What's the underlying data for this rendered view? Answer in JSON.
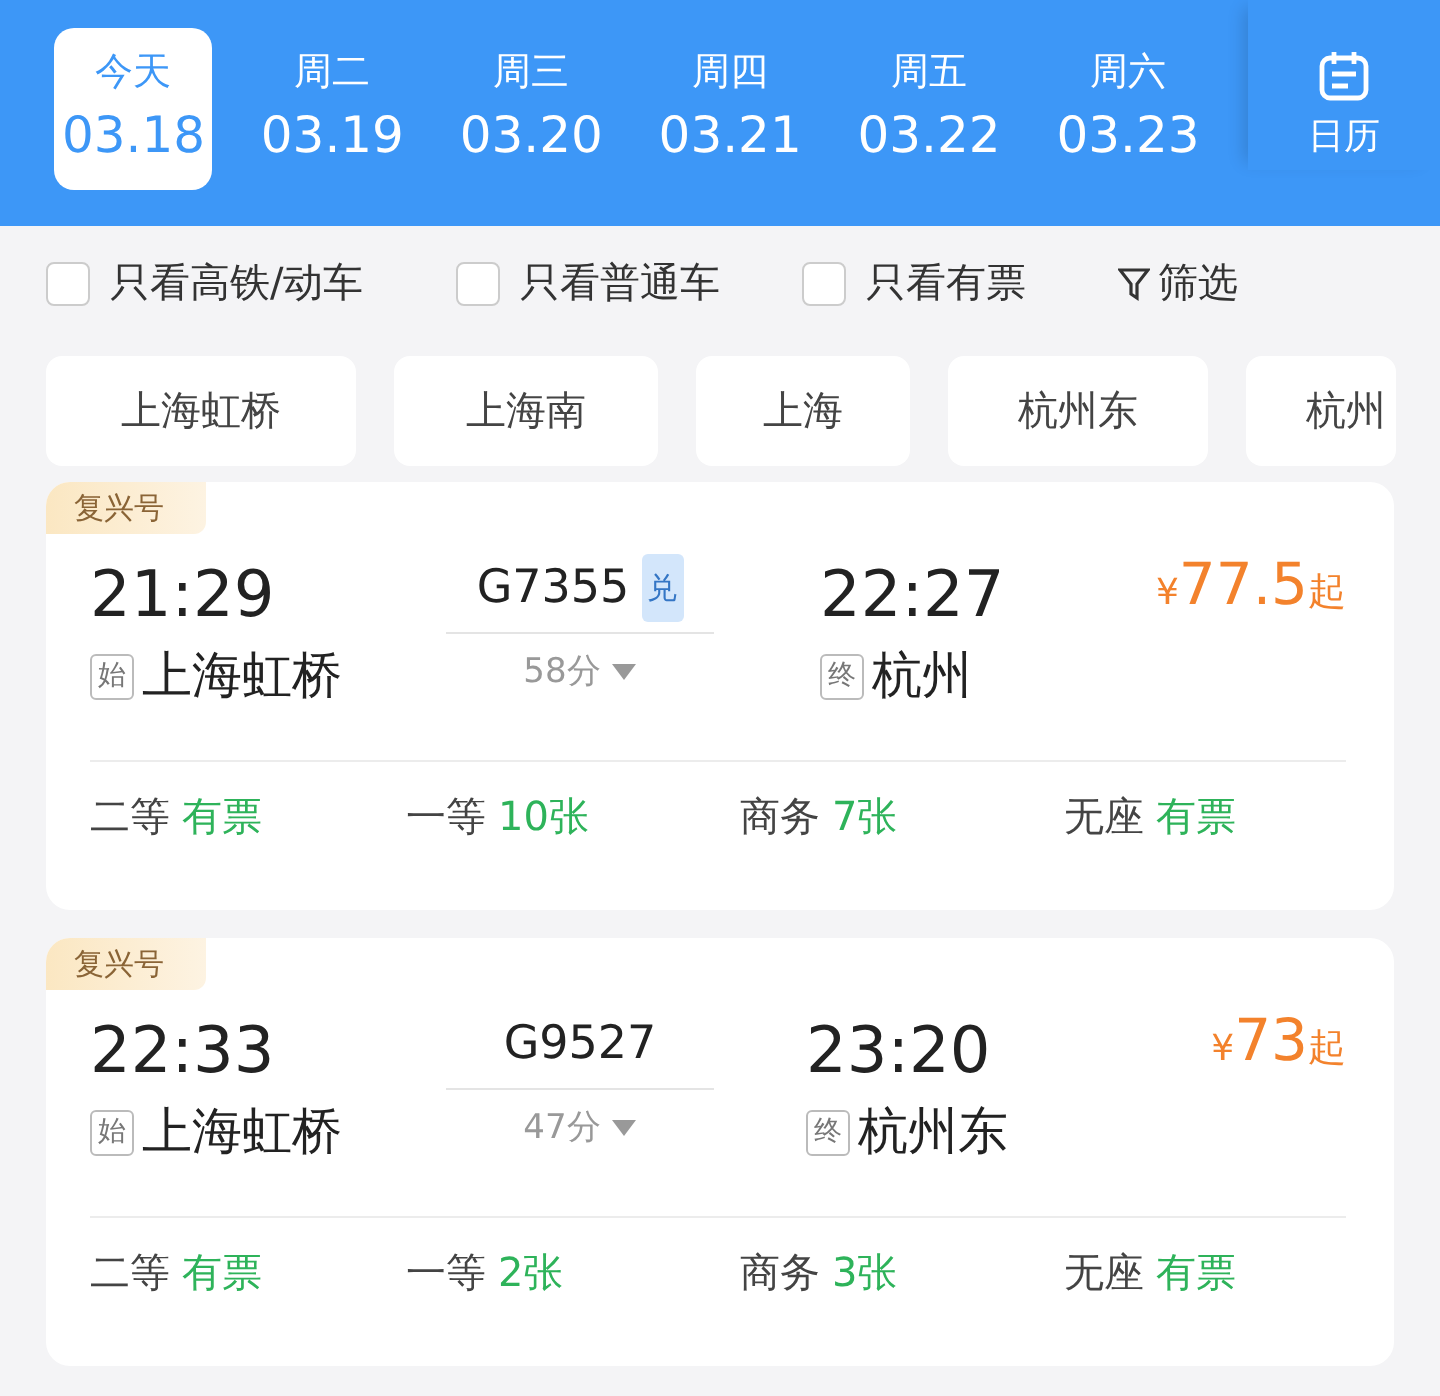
{
  "dates": [
    {
      "weekday": "今天",
      "date": "03.18",
      "selected": true
    },
    {
      "weekday": "周二",
      "date": "03.19",
      "selected": false
    },
    {
      "weekday": "周三",
      "date": "03.20",
      "selected": false
    },
    {
      "weekday": "周四",
      "date": "03.21",
      "selected": false
    },
    {
      "weekday": "周五",
      "date": "03.22",
      "selected": false
    },
    {
      "weekday": "周六",
      "date": "03.23",
      "selected": false
    }
  ],
  "calendar_button": {
    "label": "日历"
  },
  "filters": [
    {
      "label": "只看高铁/动车",
      "checked": false
    },
    {
      "label": "只看普通车",
      "checked": false
    },
    {
      "label": "只看有票",
      "checked": false
    }
  ],
  "filter_button": {
    "label": "筛选"
  },
  "stations": [
    "上海虹桥",
    "上海南",
    "上海",
    "杭州东",
    "杭州"
  ],
  "trains": [
    {
      "tag": "复兴号",
      "depart_time": "21:29",
      "train_no": "G7355",
      "badge": "兑",
      "arrive_time": "22:27",
      "currency": "¥",
      "price": "77.5",
      "price_suffix": "起",
      "origin_mark": "始",
      "origin": "上海虹桥",
      "duration": "58分",
      "dest_mark": "终",
      "destination": "杭州",
      "seats": [
        {
          "class": "二等",
          "availability": "有票"
        },
        {
          "class": "一等",
          "availability": "10张"
        },
        {
          "class": "商务",
          "availability": "7张"
        },
        {
          "class": "无座",
          "availability": "有票"
        }
      ]
    },
    {
      "tag": "复兴号",
      "depart_time": "22:33",
      "train_no": "G9527",
      "arrive_time": "23:20",
      "currency": "¥",
      "price": "73",
      "price_suffix": "起",
      "origin_mark": "始",
      "origin": "上海虹桥",
      "duration": "47分",
      "dest_mark": "终",
      "destination": "杭州东",
      "seats": [
        {
          "class": "二等",
          "availability": "有票"
        },
        {
          "class": "一等",
          "availability": "2张"
        },
        {
          "class": "商务",
          "availability": "3张"
        },
        {
          "class": "无座",
          "availability": "有票"
        }
      ]
    }
  ]
}
